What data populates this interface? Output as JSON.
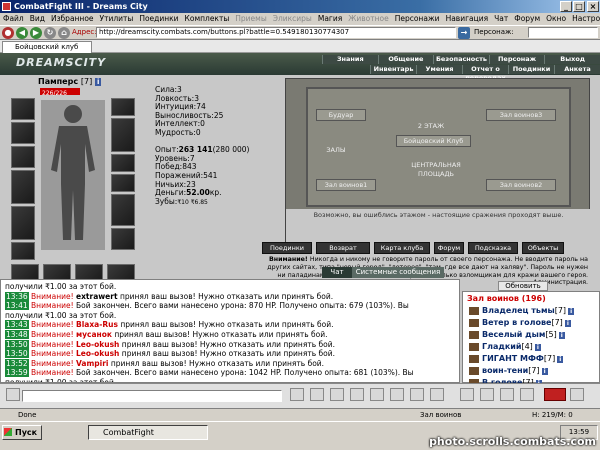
{
  "window": {
    "title": "CombatFight III - Dreams City"
  },
  "menu": [
    {
      "label": "Файл",
      "disabled": false
    },
    {
      "label": "Вид",
      "disabled": false
    },
    {
      "label": "Избранное",
      "disabled": false
    },
    {
      "label": "Утилиты",
      "disabled": false
    },
    {
      "label": "Поединки",
      "disabled": false
    },
    {
      "label": "Комплекты",
      "disabled": false
    },
    {
      "label": "Приемы",
      "disabled": true
    },
    {
      "label": "Эликсиры",
      "disabled": true
    },
    {
      "label": "Магия",
      "disabled": false
    },
    {
      "label": "Животное",
      "disabled": true
    },
    {
      "label": "Персонажи",
      "disabled": false
    },
    {
      "label": "Навигация",
      "disabled": false
    },
    {
      "label": "Чат",
      "disabled": false
    },
    {
      "label": "Форум",
      "disabled": false
    },
    {
      "label": "Окно",
      "disabled": false
    },
    {
      "label": "Настройки",
      "disabled": false
    },
    {
      "label": "?",
      "disabled": false
    }
  ],
  "toolbar": {
    "address_label": "Адрес:",
    "address": "http://dreamscity.combats.com/buttons.pl?battle=0.549180130774307",
    "person_label": "Персонаж:"
  },
  "tab": {
    "label": "Бойцовский клуб"
  },
  "game": {
    "logo": "DREAMSCITY",
    "nav_top": [
      "Знания",
      "Общение",
      "Безопасность",
      "Персонаж",
      "Выход"
    ],
    "nav_bottom": [
      "Инвентарь",
      "Умения",
      "Отчет о переводах",
      "Поединки",
      "Анкета"
    ],
    "character": {
      "name": "Памперс",
      "level": "[7]",
      "hp": "226/226"
    },
    "stats": [
      {
        "label": "Сила:",
        "value": "3"
      },
      {
        "label": "Ловкость:",
        "value": "3"
      },
      {
        "label": "Интуиция:",
        "value": "74"
      },
      {
        "label": "Выносливость:",
        "value": "25"
      },
      {
        "label": "Интеллект:",
        "value": "0"
      },
      {
        "label": "Мудрость:",
        "value": "0"
      }
    ],
    "experience": {
      "label": "Опыт:",
      "value": "263 141",
      "next": "(280 000)"
    },
    "info": [
      {
        "label": "Уровень:",
        "value": "7"
      },
      {
        "label": "Побед:",
        "value": "843"
      },
      {
        "label": "Поражений:",
        "value": "541"
      },
      {
        "label": "Ничьих:",
        "value": "23"
      }
    ],
    "money": {
      "label": "Деньги:",
      "value": "52.00",
      "unit": "кр."
    },
    "teeth": {
      "label": "Зубы:",
      "value": "₹10 ₹6.85"
    },
    "map": {
      "rooms": [
        "Будуар",
        "Зал воинов3",
        "Зал воинов1",
        "Зал воинов2",
        "2 ЭТАЖ",
        "Бойцовский Клуб",
        "ЦЕНТРАЛЬНАЯ ПЛОЩАДЬ",
        "ЗАЛЫ"
      ],
      "caption": "Возможно, вы ошиблись этажом - настоящие сражения проходят выше."
    },
    "buttons": [
      "Поединки",
      "Возврат",
      "Карта клуба",
      "Форум",
      "Подсказка",
      "Объекты"
    ],
    "warning": {
      "title": "Внимание!",
      "text": "Никогда и никому не говорите пароль от своего персонажа. Не вводите пароль на других сайтах, типа \"новый город\", \"лотерея\", \"там, где все дают на халяву\". Пароль не нужен ни паладинам, ни кланам, ни администрации, только взломщикам для кражи вашего героя.",
      "sign": "Администрация."
    }
  },
  "chat": {
    "tabs": [
      "Чат",
      "Системные сообщения"
    ],
    "lines": [
      {
        "ts": "",
        "pre": "получили ₹1.00 за этот бой.",
        "nick": "",
        "post": ""
      },
      {
        "ts": "13:36",
        "pre": "Внимание!",
        "nick": "extrawert",
        "post": " принял ваш вызов! Нужно отказать или принять бой."
      },
      {
        "ts": "13:41",
        "pre": "Внимание!",
        "nick": "",
        "post": " Бой закончен. Всего вами нанесено урона: 870 HP. Получено опыта: 679 (103%). Вы"
      },
      {
        "ts": "",
        "pre": "получили ₹1.00 за этот бой.",
        "nick": "",
        "post": ""
      },
      {
        "ts": "13:43",
        "pre": "Внимание!",
        "nick": "Blaxa-Rus",
        "post": " принял ваш вызов! Нужно отказать или принять бой."
      },
      {
        "ts": "13:48",
        "pre": "Внимание!",
        "nick": "мусанок",
        "post": " принял ваш вызов! Нужно отказать или принять бой."
      },
      {
        "ts": "13:50",
        "pre": "Внимание!",
        "nick": "Leo-okush",
        "post": " принял ваш вызов! Нужно отказать или принять бой."
      },
      {
        "ts": "13:50",
        "pre": "Внимание!",
        "nick": "Leo-okush",
        "post": " принял ваш вызов! Нужно отказать или принять бой."
      },
      {
        "ts": "13:52",
        "pre": "Внимание!",
        "nick": "Vampiri",
        "post": " принял ваш вызов! Нужно отказать или принять бой."
      },
      {
        "ts": "13:59",
        "pre": "Внимание!",
        "nick": "",
        "post": " Бой закончен. Всего вами нанесено урона: 1042 HP. Получено опыта: 681 (103%). Вы"
      },
      {
        "ts": "",
        "pre": "получили ₹1.00 за этот бой.",
        "nick": "",
        "post": ""
      }
    ]
  },
  "roster": {
    "refresh": "Обновить",
    "title": "Зал воинов (196)",
    "players": [
      {
        "name": "Владелец тьмы",
        "level": "[7]"
      },
      {
        "name": "Ветер в голове",
        "level": "[7]"
      },
      {
        "name": "Веселый дым",
        "level": "[5]"
      },
      {
        "name": "Гладкий",
        "level": "[4]"
      },
      {
        "name": "ГИГАНТ МФФ",
        "level": "[7]"
      },
      {
        "name": "воин-тени",
        "level": "[7]"
      },
      {
        "name": "В голове",
        "level": "[7]"
      }
    ]
  },
  "statusbar": {
    "left": "Done",
    "mid": "Зал воинов",
    "right": "H: 219/M: 0"
  },
  "taskbar": {
    "start": "Пуск",
    "task": "CombatFight",
    "time": "13:59"
  },
  "watermark": "photo.scrolls.combats.com"
}
